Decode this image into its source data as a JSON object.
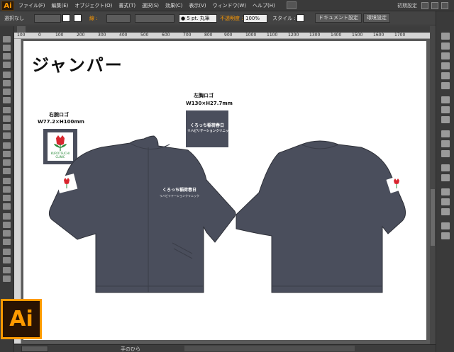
{
  "app": {
    "logo": "Ai",
    "badge": "Ai",
    "workspace": "初期設定"
  },
  "menu": [
    "ファイル(F)",
    "編集(E)",
    "オブジェクト(O)",
    "書式(T)",
    "選択(S)",
    "効果(C)",
    "表示(V)",
    "ウィンドウ(W)",
    "ヘルプ(H)"
  ],
  "control": {
    "selection": "選択なし",
    "stroke_label": "線 :",
    "brush": "● 5 pt. 丸筆",
    "opacity_label": "不透明度 :",
    "opacity": "100%",
    "style_label": "スタイル :",
    "doc_settings": "ドキュメント設定",
    "prefs": "環境設定"
  },
  "ruler": {
    "marks": [
      "100",
      "0",
      "100",
      "200",
      "300",
      "400",
      "500",
      "600",
      "700",
      "800",
      "900",
      "1000",
      "1100",
      "1200",
      "1300",
      "1400",
      "1500",
      "1600",
      "1700"
    ]
  },
  "status": {
    "tool": "手のひら"
  },
  "artwork": {
    "title": "ジャンパー",
    "right_arm_label": "右腕ロゴ",
    "right_arm_size": "W77.2×H100mm",
    "left_chest_label": "左胸ロゴ",
    "left_chest_size": "W130×H27.7mm",
    "logo_line1": "くろっち稲荷春日",
    "logo_line2": "リハビリテーションクリニック",
    "logo_en": "KUROTSUCHI",
    "logo_en2": "CLINIC"
  },
  "colors": {
    "jacket": "#4a4e5c",
    "accent": "#ff9a00",
    "flower": "#d8262e",
    "leaf": "#2a8a3a"
  },
  "icons": [
    "selection-icon",
    "direct-selection-icon",
    "magic-wand-icon",
    "lasso-icon",
    "pen-icon",
    "type-icon",
    "line-icon",
    "rectangle-icon",
    "brush-icon",
    "pencil-icon",
    "blob-brush-icon",
    "eraser-icon",
    "rotate-icon",
    "scale-icon",
    "width-icon",
    "free-transform-icon",
    "shape-builder-icon",
    "perspective-icon",
    "mesh-icon",
    "gradient-icon",
    "eyedropper-icon",
    "blend-icon",
    "symbol-sprayer-icon",
    "graph-icon",
    "artboard-icon",
    "slice-icon",
    "hand-icon",
    "zoom-icon"
  ]
}
